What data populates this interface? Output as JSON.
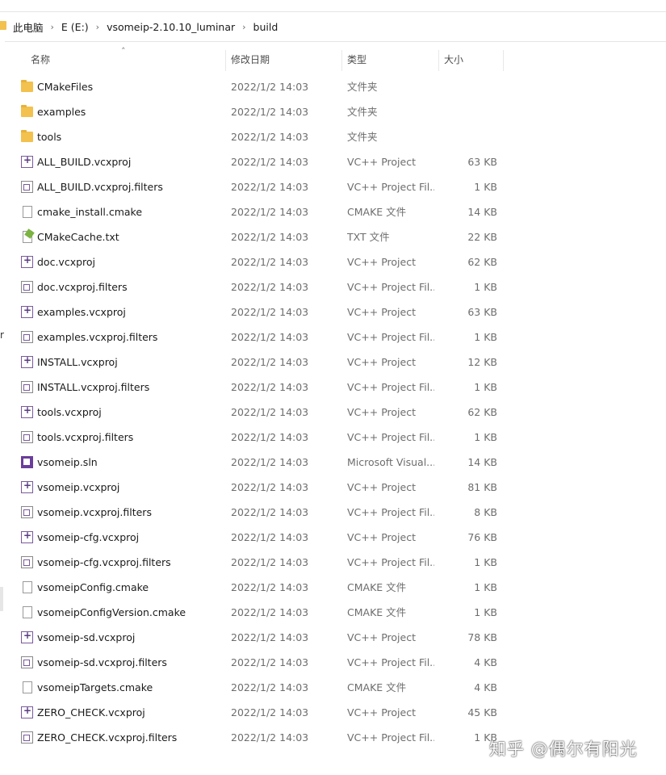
{
  "address_bar": {
    "breadcrumbs": [
      "此电脑",
      "E (E:)",
      "vsomeip-2.10.10_luminar",
      "build"
    ]
  },
  "columns": {
    "name": "名称",
    "date": "修改日期",
    "type": "类型",
    "size": "大小"
  },
  "files": [
    {
      "name": "CMakeFiles",
      "date": "2022/1/2 14:03",
      "type": "文件夹",
      "size": "",
      "icon": "folder-icon"
    },
    {
      "name": "examples",
      "date": "2022/1/2 14:03",
      "type": "文件夹",
      "size": "",
      "icon": "folder-icon"
    },
    {
      "name": "tools",
      "date": "2022/1/2 14:03",
      "type": "文件夹",
      "size": "",
      "icon": "folder-icon"
    },
    {
      "name": "ALL_BUILD.vcxproj",
      "date": "2022/1/2 14:03",
      "type": "VC++ Project",
      "size": "63 KB",
      "icon": "vcxproj-icon"
    },
    {
      "name": "ALL_BUILD.vcxproj.filters",
      "date": "2022/1/2 14:03",
      "type": "VC++ Project Fil...",
      "size": "1 KB",
      "icon": "filters-icon"
    },
    {
      "name": "cmake_install.cmake",
      "date": "2022/1/2 14:03",
      "type": "CMAKE 文件",
      "size": "14 KB",
      "icon": "document-icon"
    },
    {
      "name": "CMakeCache.txt",
      "date": "2022/1/2 14:03",
      "type": "TXT 文件",
      "size": "22 KB",
      "icon": "text-file-icon"
    },
    {
      "name": "doc.vcxproj",
      "date": "2022/1/2 14:03",
      "type": "VC++ Project",
      "size": "62 KB",
      "icon": "vcxproj-icon"
    },
    {
      "name": "doc.vcxproj.filters",
      "date": "2022/1/2 14:03",
      "type": "VC++ Project Fil...",
      "size": "1 KB",
      "icon": "filters-icon"
    },
    {
      "name": "examples.vcxproj",
      "date": "2022/1/2 14:03",
      "type": "VC++ Project",
      "size": "63 KB",
      "icon": "vcxproj-icon"
    },
    {
      "name": "examples.vcxproj.filters",
      "date": "2022/1/2 14:03",
      "type": "VC++ Project Fil...",
      "size": "1 KB",
      "icon": "filters-icon"
    },
    {
      "name": "INSTALL.vcxproj",
      "date": "2022/1/2 14:03",
      "type": "VC++ Project",
      "size": "12 KB",
      "icon": "vcxproj-icon"
    },
    {
      "name": "INSTALL.vcxproj.filters",
      "date": "2022/1/2 14:03",
      "type": "VC++ Project Fil...",
      "size": "1 KB",
      "icon": "filters-icon"
    },
    {
      "name": "tools.vcxproj",
      "date": "2022/1/2 14:03",
      "type": "VC++ Project",
      "size": "62 KB",
      "icon": "vcxproj-icon"
    },
    {
      "name": "tools.vcxproj.filters",
      "date": "2022/1/2 14:03",
      "type": "VC++ Project Fil...",
      "size": "1 KB",
      "icon": "filters-icon"
    },
    {
      "name": "vsomeip.sln",
      "date": "2022/1/2 14:03",
      "type": "Microsoft Visual...",
      "size": "14 KB",
      "icon": "solution-icon"
    },
    {
      "name": "vsomeip.vcxproj",
      "date": "2022/1/2 14:03",
      "type": "VC++ Project",
      "size": "81 KB",
      "icon": "vcxproj-icon"
    },
    {
      "name": "vsomeip.vcxproj.filters",
      "date": "2022/1/2 14:03",
      "type": "VC++ Project Fil...",
      "size": "8 KB",
      "icon": "filters-icon"
    },
    {
      "name": "vsomeip-cfg.vcxproj",
      "date": "2022/1/2 14:03",
      "type": "VC++ Project",
      "size": "76 KB",
      "icon": "vcxproj-icon"
    },
    {
      "name": "vsomeip-cfg.vcxproj.filters",
      "date": "2022/1/2 14:03",
      "type": "VC++ Project Fil...",
      "size": "1 KB",
      "icon": "filters-icon"
    },
    {
      "name": "vsomeipConfig.cmake",
      "date": "2022/1/2 14:03",
      "type": "CMAKE 文件",
      "size": "1 KB",
      "icon": "document-icon"
    },
    {
      "name": "vsomeipConfigVersion.cmake",
      "date": "2022/1/2 14:03",
      "type": "CMAKE 文件",
      "size": "1 KB",
      "icon": "document-icon"
    },
    {
      "name": "vsomeip-sd.vcxproj",
      "date": "2022/1/2 14:03",
      "type": "VC++ Project",
      "size": "78 KB",
      "icon": "vcxproj-icon"
    },
    {
      "name": "vsomeip-sd.vcxproj.filters",
      "date": "2022/1/2 14:03",
      "type": "VC++ Project Fil...",
      "size": "4 KB",
      "icon": "filters-icon"
    },
    {
      "name": "vsomeipTargets.cmake",
      "date": "2022/1/2 14:03",
      "type": "CMAKE 文件",
      "size": "4 KB",
      "icon": "document-icon"
    },
    {
      "name": "ZERO_CHECK.vcxproj",
      "date": "2022/1/2 14:03",
      "type": "VC++ Project",
      "size": "45 KB",
      "icon": "vcxproj-icon"
    },
    {
      "name": "ZERO_CHECK.vcxproj.filters",
      "date": "2022/1/2 14:03",
      "type": "VC++ Project Fil...",
      "size": "1 KB",
      "icon": "filters-icon"
    }
  ],
  "sidebar_fragment": "r",
  "watermark": "知乎 @偶尔有阳光"
}
